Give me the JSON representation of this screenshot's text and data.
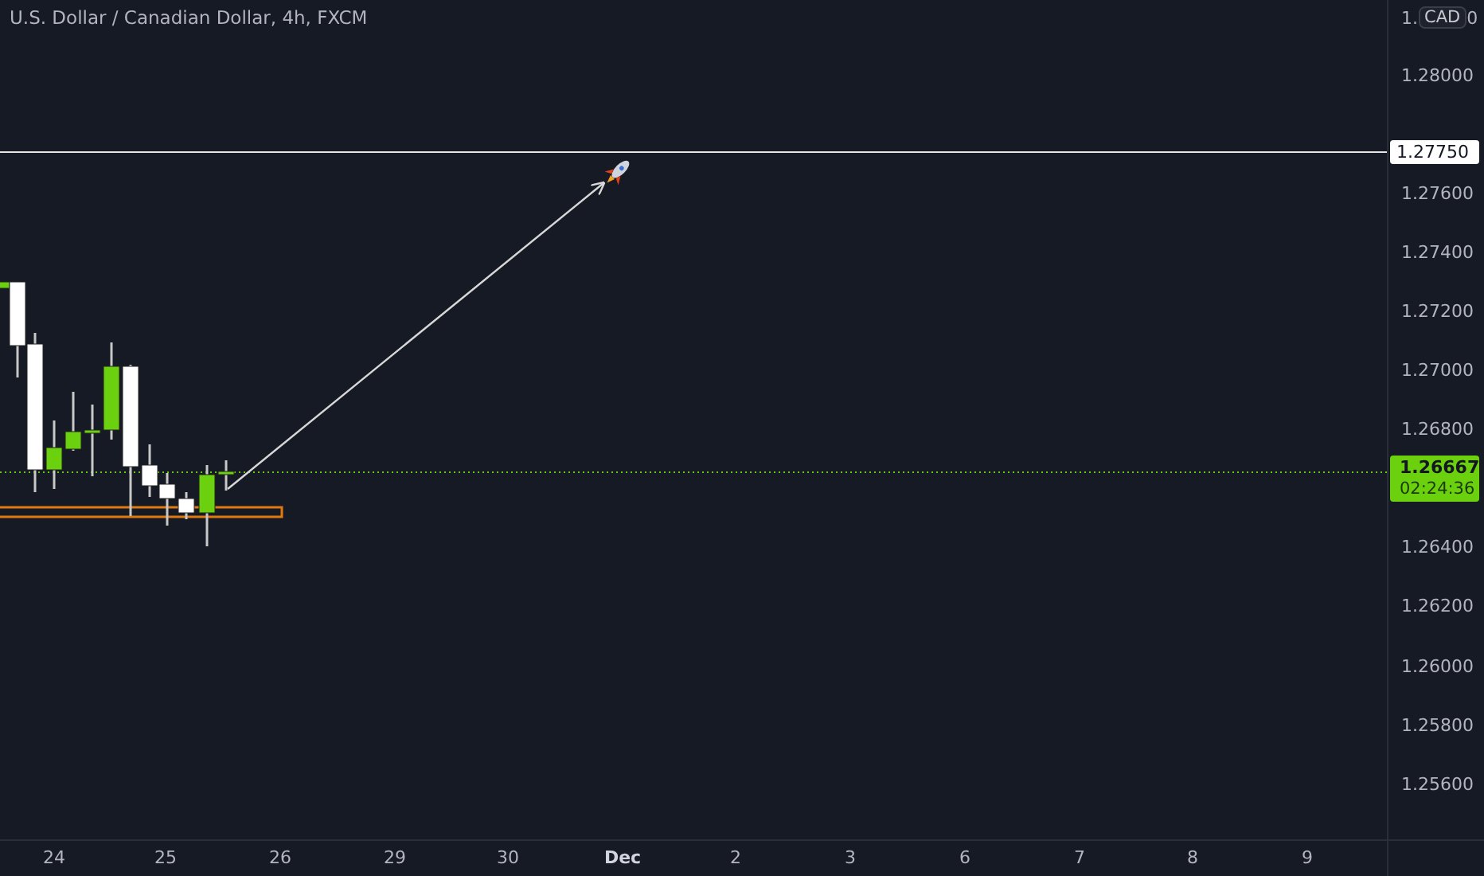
{
  "chart_title": "U.S. Dollar / Canadian Dollar, 4h, FXCM",
  "price_axis": {
    "top_label_start": "1.",
    "top_label_end": "0",
    "currency": "CAD",
    "ticks": [
      "1.28000",
      "1.27600",
      "1.27400",
      "1.27200",
      "1.27000",
      "1.26800",
      "1.26400",
      "1.26200",
      "1.26000",
      "1.25800",
      "1.25600"
    ],
    "target_label": "1.27750",
    "last_price": "1.26667",
    "countdown": "02:24:36"
  },
  "time_axis": [
    {
      "label": "24",
      "bold": false
    },
    {
      "label": "25",
      "bold": false
    },
    {
      "label": "26",
      "bold": false
    },
    {
      "label": "29",
      "bold": false
    },
    {
      "label": "30",
      "bold": false
    },
    {
      "label": "Dec",
      "bold": true
    },
    {
      "label": "2",
      "bold": false
    },
    {
      "label": "3",
      "bold": false
    },
    {
      "label": "6",
      "bold": false
    },
    {
      "label": "7",
      "bold": false
    },
    {
      "label": "8",
      "bold": false
    },
    {
      "label": "9",
      "bold": false
    }
  ]
}
